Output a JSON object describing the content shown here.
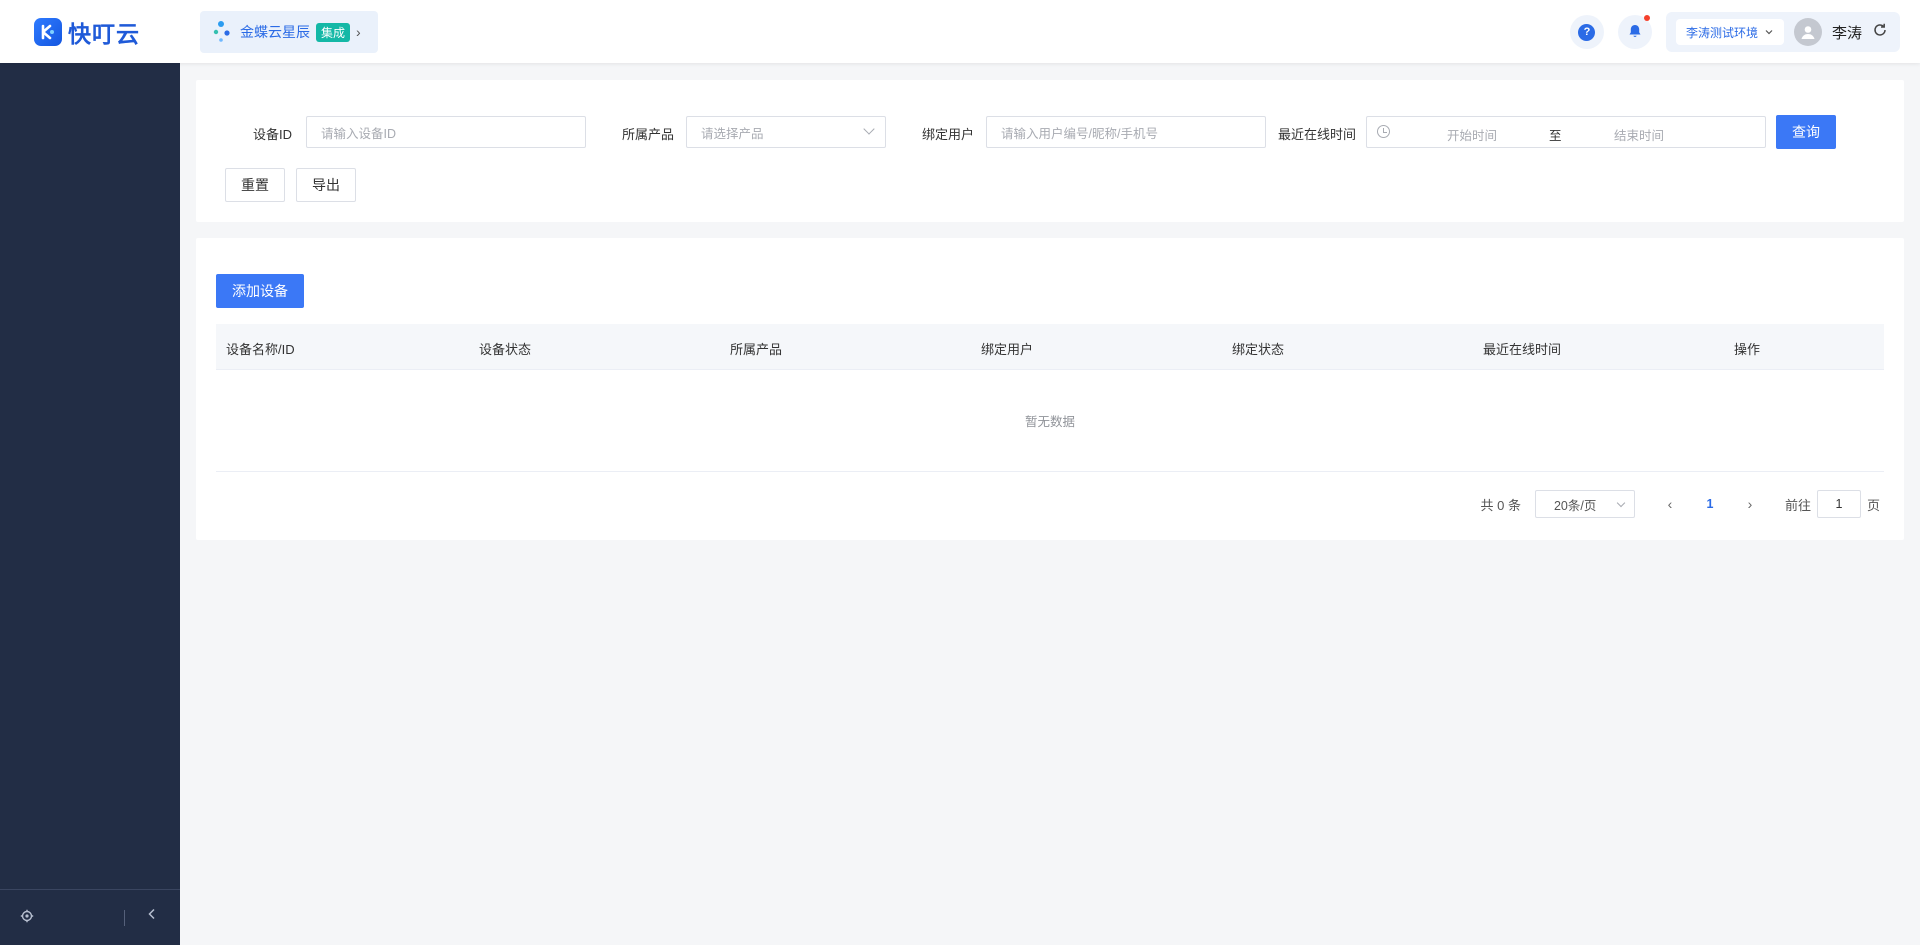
{
  "header": {
    "logo_text": "快叮云",
    "brand_name": "金蝶云星辰",
    "brand_tag": "集成",
    "env_label": "李涛测试环境",
    "user_name": "李涛",
    "help_icon_text": "?"
  },
  "filters": {
    "device_id_label": "设备ID",
    "device_id_placeholder": "请输入设备ID",
    "product_label": "所属产品",
    "product_placeholder": "请选择产品",
    "bind_user_label": "绑定用户",
    "bind_user_placeholder": "请输入用户编号/昵称/手机号",
    "last_online_label": "最近在线时间",
    "start_placeholder": "开始时间",
    "range_sep": "至",
    "end_placeholder": "结束时间",
    "query_label": "查询",
    "reset_label": "重置",
    "export_label": "导出"
  },
  "table": {
    "add_label": "添加设备",
    "columns": [
      "设备名称/ID",
      "设备状态",
      "所属产品",
      "绑定用户",
      "绑定状态",
      "最近在线时间",
      "操作"
    ],
    "empty_text": "暂无数据"
  },
  "pagination": {
    "total_text": "共 0 条",
    "page_size": "20条/页",
    "current_page": "1",
    "goto_label": "前往",
    "goto_value": "1",
    "page_suffix": "页"
  },
  "colors": {
    "primary": "#3b78f6",
    "sidebar_bg": "#222d45",
    "brand_tag": "#14b8a6",
    "notice_dot": "#f5402c"
  },
  "icons": [
    "logo-icon",
    "brand-dots-icon",
    "chevron-right-icon",
    "help-icon",
    "bell-icon",
    "chevron-down-icon",
    "avatar-icon",
    "refresh-icon",
    "gear-icon",
    "collapse-icon",
    "clock-icon"
  ]
}
